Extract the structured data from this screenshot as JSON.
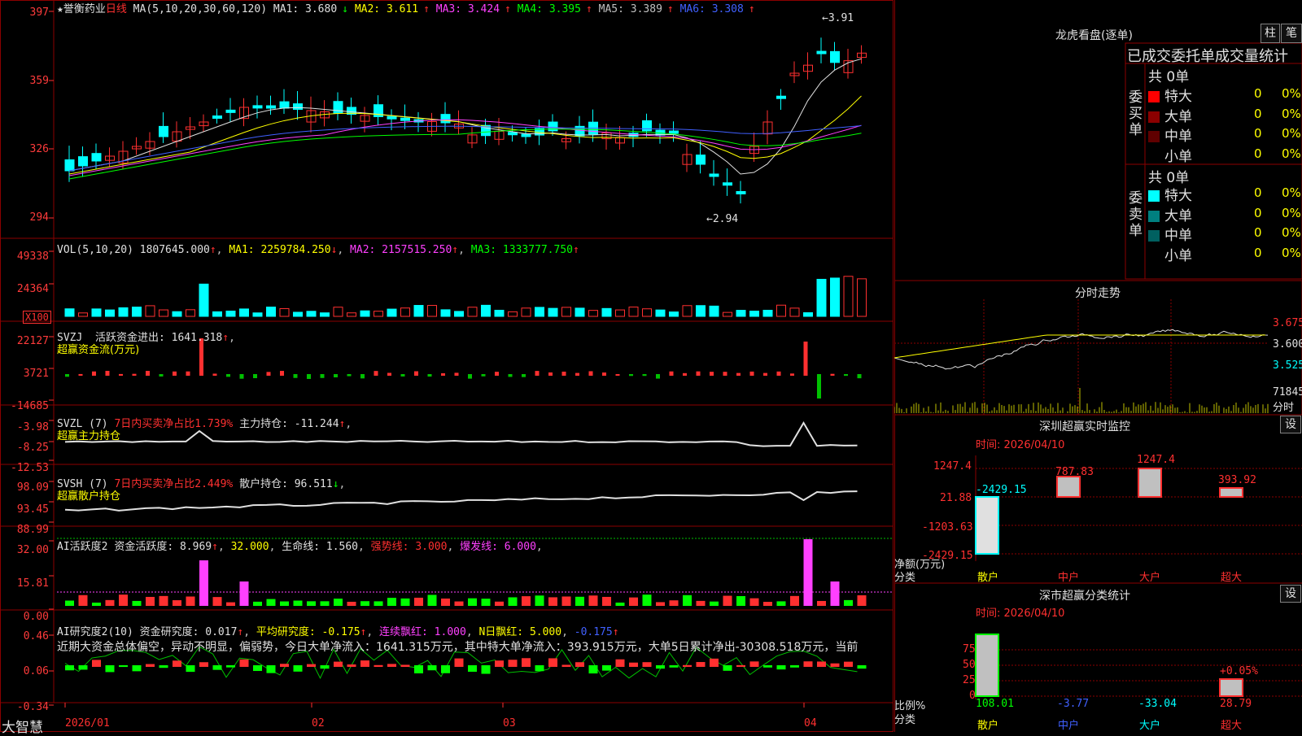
{
  "stock": {
    "name": "★誉衡药业",
    "period": "日线"
  },
  "price_panel": {
    "ma_label": "MA(5,10,20,30,60,120)",
    "ma": [
      {
        "label": "MA1: 3.680",
        "arrow": "↓",
        "color": "#e0e0e0"
      },
      {
        "label": "MA2: 3.611",
        "arrow": "↑",
        "color": "#ffff00"
      },
      {
        "label": "MA3: 3.424",
        "arrow": "↑",
        "color": "#ff40ff"
      },
      {
        "label": "MA4: 3.395",
        "arrow": "↑",
        "color": "#00ff00"
      },
      {
        "label": "MA5: 3.389",
        "arrow": "↑",
        "color": "#c0c0c0"
      },
      {
        "label": "MA6: 3.308",
        "arrow": "↑",
        "color": "#4060ff"
      }
    ],
    "yticks": [
      "397",
      "359",
      "326",
      "294"
    ],
    "high_mark": "3.91",
    "low_mark": "2.94"
  },
  "vol_panel": {
    "title": "VOL(5,10,20)",
    "value": "1807645.000",
    "ma1": "MA1: 2259784.250",
    "ma2": "MA2: 2157515.250",
    "ma3": "MA3: 1333777.750",
    "yticks": [
      "49338",
      "24364"
    ],
    "unit": "X100"
  },
  "svzj_panel": {
    "title": "SVZJ",
    "text": "活跃资金进出: 1641.318",
    "sub": "超赢资金流(万元)",
    "yticks": [
      "22127",
      "3721",
      "-14685"
    ]
  },
  "svzl_panel": {
    "title": "SVZL (7)",
    "pct": "7日内买卖净占比1.739%",
    "text": "主力持仓: -11.244",
    "sub": "超赢主力持仓",
    "yticks": [
      "-3.98",
      "-8.25",
      "-12.53"
    ]
  },
  "svsh_panel": {
    "title": "SVSH (7)",
    "pct": "7日内买卖净占比2.449%",
    "text": "散户持仓: 96.511",
    "sub": "超赢散户持仓",
    "yticks": [
      "98.09",
      "93.45",
      "88.99"
    ]
  },
  "ai_hy_panel": {
    "title": "AI活跃度2",
    "text": "资金活跃度: 8.969",
    "v2": "32.000",
    "life": "生命线: 1.560",
    "strong": "强势线: 3.000",
    "burst": "爆发线: 6.000",
    "yticks": [
      "32.00",
      "15.81",
      "0.00"
    ]
  },
  "ai_yj_panel": {
    "title": "AI研究度2(10)",
    "text": "资金研究度: 0.017",
    "avg": "平均研究度: -0.175",
    "red": "连续飘红: 1.000",
    "nred": "N日飘红: 5.000",
    "last": "-0.175",
    "comment": "近期大资金总体偏空，异动不明显，偏弱势，今日大单净流入：1641.315万元，其中特大单净流入：393.915万元，大单5日累计净出-30308.518万元，当前",
    "yticks": [
      "0.46",
      "0.06",
      "-0.34"
    ]
  },
  "xaxis": {
    "labels": [
      "2026/01",
      "02",
      "03",
      "04"
    ],
    "brand": "大智慧"
  },
  "right": {
    "lhb_title": "龙虎看盘(逐单)",
    "buttons": [
      "柱",
      "笔"
    ],
    "stat_header": "已成交委托单成交量统计",
    "buy": {
      "side": "委买单",
      "total": "共 0单",
      "rows": [
        {
          "label": "特大",
          "n": "0",
          "p": "0%",
          "color": "#ff0000"
        },
        {
          "label": "大单",
          "n": "0",
          "p": "0%",
          "color": "#8b0000"
        },
        {
          "label": "中单",
          "n": "0",
          "p": "0%",
          "color": "#600000"
        },
        {
          "label": "小单",
          "n": "0",
          "p": "0%",
          "color": "#000000"
        }
      ]
    },
    "sell": {
      "side": "委卖单",
      "total": "共 0单",
      "rows": [
        {
          "label": "特大",
          "n": "0",
          "p": "0%",
          "color": "#00ffff"
        },
        {
          "label": "大单",
          "n": "0",
          "p": "0%",
          "color": "#008080"
        },
        {
          "label": "中单",
          "n": "0",
          "p": "0%",
          "color": "#006060"
        },
        {
          "label": "小单",
          "n": "0",
          "p": "0%",
          "color": "#000000"
        }
      ]
    },
    "fs_title": "分时走势",
    "fs_prices": [
      "3.675",
      "3.600",
      "3.525"
    ],
    "fs_vol": "71845",
    "fs_unit": "分时",
    "sz_title": "深圳超赢实时监控",
    "sz_time": "时间: 2026/04/10",
    "set": "设",
    "sz_yticks": [
      "1247.4",
      "21.88",
      "-1203.63",
      "-2429.15"
    ],
    "sz_bars": [
      {
        "cat": "散户",
        "v": "-2429.15"
      },
      {
        "cat": "中户",
        "v": "787.83"
      },
      {
        "cat": "大户",
        "v": "1247.4"
      },
      {
        "cat": "超大",
        "v": "393.92"
      }
    ],
    "sz_ylabel": "净额(万元)",
    "sz_xlabel": "分类",
    "fl_title": "深市超赢分类统计",
    "fl_time": "时间: 2026/04/10",
    "fl_yticks": [
      "75",
      "50",
      "25",
      "0"
    ],
    "fl_top": "+0.05%",
    "fl_vals": [
      {
        "cat": "散户",
        "v": "108.01"
      },
      {
        "cat": "中户",
        "v": "-3.77"
      },
      {
        "cat": "大户",
        "v": "-33.04"
      },
      {
        "cat": "超大",
        "v": "28.79"
      }
    ],
    "fl_ylabel": "比例%",
    "fl_xlabel": "分类"
  }
}
